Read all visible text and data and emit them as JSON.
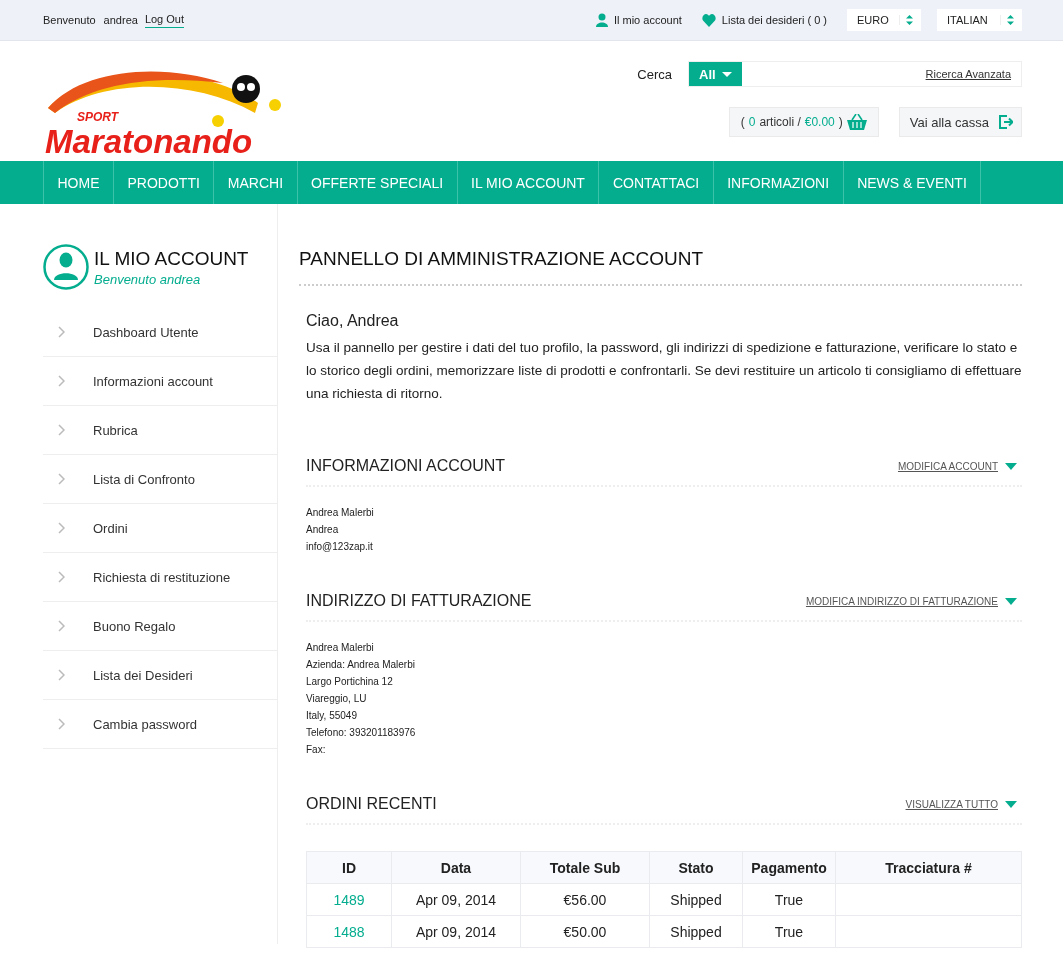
{
  "topbar": {
    "welcome": "Benvenuto",
    "user": "andrea",
    "logout": "Log Out",
    "account": "Il mio account",
    "wishlist": "Lista dei desideri ( 0 )",
    "currency": "EURO",
    "language": "ITALIAN"
  },
  "logo": {
    "tag": "SPORT",
    "name": "Maratonando"
  },
  "search": {
    "label": "Cerca",
    "category": "All",
    "advanced": "Ricerca Avanzata"
  },
  "cart": {
    "open": "(",
    "count": "0",
    "items": "articoli /",
    "total": "€0.00",
    "close": ")"
  },
  "checkout": "Vai alla cassa",
  "nav": [
    {
      "label": "HOME"
    },
    {
      "label": "PRODOTTI"
    },
    {
      "label": "MARCHI"
    },
    {
      "label": "OFFERTE SPECIALI"
    },
    {
      "label": "IL MIO ACCOUNT"
    },
    {
      "label": "CONTATTACI"
    },
    {
      "label": "INFORMAZIONI"
    },
    {
      "label": "NEWS & EVENTI"
    }
  ],
  "sidebar": {
    "title": "IL MIO ACCOUNT",
    "subtitle": "Benvenuto andrea",
    "items": [
      "Dashboard Utente",
      "Informazioni account",
      "Rubrica",
      "Lista di Confronto",
      "Ordini",
      "Richiesta di restituzione",
      "Buono Regalo",
      "Lista dei Desideri",
      "Cambia password"
    ]
  },
  "main": {
    "title": "PANNELLO DI AMMINISTRAZIONE ACCOUNT",
    "greeting": "Ciao, Andrea",
    "intro": "Usa il pannello per gestire i dati del tuo profilo, la password, gli indirizzi di spedizione e fatturazione, verificare lo stato e lo storico degli ordini, memorizzare liste di prodotti e confrontarli. Se devi restituire un articolo ti consigliamo di effettuare una richiesta di ritorno.",
    "sections": [
      {
        "title": "INFORMAZIONI ACCOUNT",
        "link": "MODIFICA ACCOUNT",
        "lines": [
          "Andrea Malerbi",
          "Andrea",
          "info@123zap.it"
        ]
      },
      {
        "title": "INDIRIZZO DI FATTURAZIONE",
        "link": "MODIFICA INDIRIZZO DI FATTURAZIONE",
        "lines": [
          "Andrea Malerbi",
          "Azienda: Andrea Malerbi",
          "Largo Portichina 12",
          "Viareggio, LU",
          "Italy, 55049",
          "Telefono: 393201183976",
          "Fax:"
        ]
      }
    ],
    "orders": {
      "title": "ORDINI RECENTI",
      "link": "VISUALIZZA TUTTO",
      "columns": [
        "ID",
        "Data",
        "Totale Sub",
        "Stato",
        "Pagamento",
        "Tracciatura #"
      ],
      "rows": [
        [
          "1489",
          "Apr 09, 2014",
          "€56.00",
          "Shipped",
          "True",
          ""
        ],
        [
          "1488",
          "Apr 09, 2014",
          "€50.00",
          "Shipped",
          "True",
          ""
        ]
      ]
    }
  }
}
